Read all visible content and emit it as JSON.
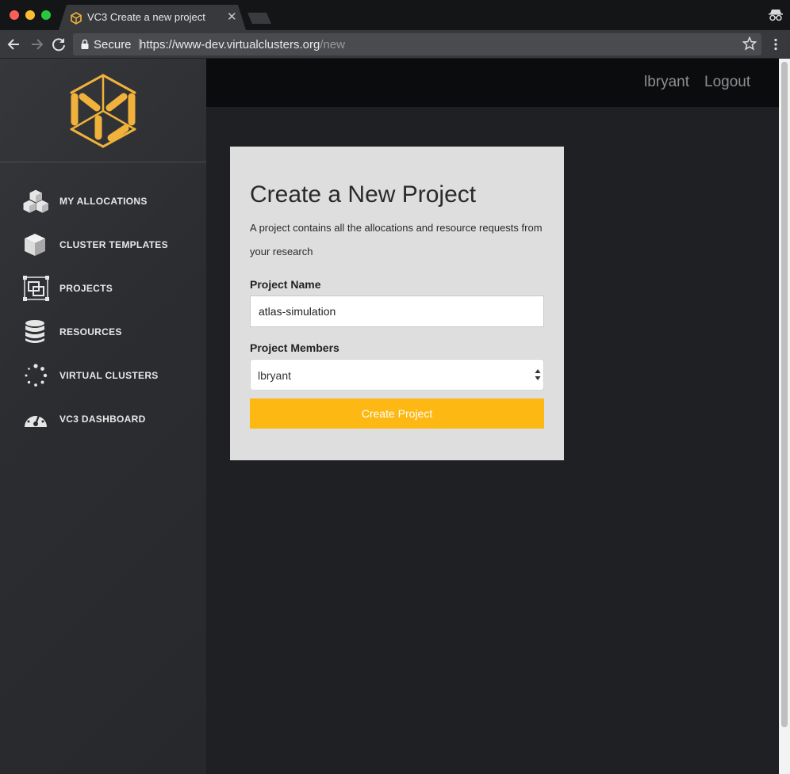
{
  "browser": {
    "tab_title": "VC3 Create a new project",
    "secure_label": "Secure",
    "url_host": "https://www-dev.virtualclusters.org",
    "url_path": "/new"
  },
  "header": {
    "username": "lbryant",
    "logout": "Logout"
  },
  "sidebar": {
    "items": [
      {
        "label": "MY ALLOCATIONS",
        "icon": "cubes-icon"
      },
      {
        "label": "CLUSTER TEMPLATES",
        "icon": "cube-icon"
      },
      {
        "label": "PROJECTS",
        "icon": "projects-icon"
      },
      {
        "label": "RESOURCES",
        "icon": "database-icon"
      },
      {
        "label": "VIRTUAL CLUSTERS",
        "icon": "spinner-icon"
      },
      {
        "label": "VC3 DASHBOARD",
        "icon": "dashboard-icon"
      }
    ]
  },
  "form": {
    "title": "Create a New Project",
    "description": "A project contains all the allocations and resource requests from your research",
    "name_label": "Project Name",
    "name_value": "atlas-simulation",
    "members_label": "Project Members",
    "members_value": "lbryant",
    "submit_label": "Create Project"
  },
  "colors": {
    "accent": "#fdb813",
    "sidebar": "#2b2d31",
    "topbar": "#0b0c0e",
    "background": "#1f2024"
  }
}
